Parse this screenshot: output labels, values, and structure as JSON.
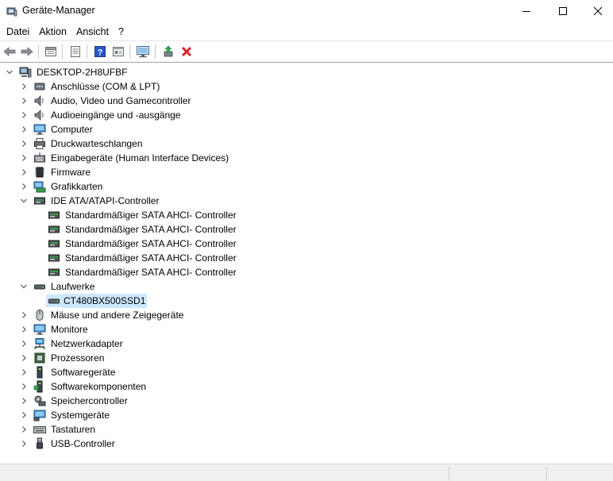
{
  "window": {
    "title": "Geräte-Manager"
  },
  "menu": {
    "items": [
      "Datei",
      "Aktion",
      "Ansicht",
      "?"
    ]
  },
  "toolbar": {
    "buttons": [
      "back-arrow-icon",
      "forward-arrow-icon",
      "properties-sheet-icon",
      "list-view-icon",
      "help-icon",
      "details-view-icon",
      "scan-hardware-icon",
      "update-driver-icon",
      "uninstall-x-icon"
    ]
  },
  "tree": {
    "root": {
      "label": "DESKTOP-2H8UFBF"
    },
    "items": [
      {
        "label": "Anschlüsse (COM & LPT)",
        "icon": "port-icon"
      },
      {
        "label": "Audio, Video und Gamecontroller",
        "icon": "speaker-icon"
      },
      {
        "label": "Audioeingänge und -ausgänge",
        "icon": "speaker-icon"
      },
      {
        "label": "Computer",
        "icon": "monitor-icon"
      },
      {
        "label": "Druckwarteschlangen",
        "icon": "printer-icon"
      },
      {
        "label": "Eingabegeräte (Human Interface Devices)",
        "icon": "hid-icon"
      },
      {
        "label": "Firmware",
        "icon": "chip-icon"
      },
      {
        "label": "Grafikkarten",
        "icon": "display-adapter-icon"
      },
      {
        "label": "IDE ATA/ATAPI-Controller",
        "icon": "controller-icon"
      },
      {
        "label": "Standardmäßiger SATA AHCI- Controller",
        "icon": "controller-icon"
      },
      {
        "label": "Standardmäßiger SATA AHCI- Controller",
        "icon": "controller-icon"
      },
      {
        "label": "Standardmäßiger SATA AHCI- Controller",
        "icon": "controller-icon"
      },
      {
        "label": "Standardmäßiger SATA AHCI- Controller",
        "icon": "controller-icon"
      },
      {
        "label": "Standardmäßiger SATA AHCI- Controller",
        "icon": "controller-icon"
      },
      {
        "label": "Laufwerke",
        "icon": "drive-icon"
      },
      {
        "label": "CT480BX500SSD1",
        "icon": "drive-icon"
      },
      {
        "label": "Mäuse und andere Zeigegeräte",
        "icon": "mouse-icon"
      },
      {
        "label": "Monitore",
        "icon": "monitor-icon"
      },
      {
        "label": "Netzwerkadapter",
        "icon": "network-icon"
      },
      {
        "label": "Prozessoren",
        "icon": "cpu-icon"
      },
      {
        "label": "Softwaregeräte",
        "icon": "software-device-icon"
      },
      {
        "label": "Softwarekomponenten",
        "icon": "software-component-icon"
      },
      {
        "label": "Speichercontroller",
        "icon": "storage-controller-icon"
      },
      {
        "label": "Systemgeräte",
        "icon": "system-icon"
      },
      {
        "label": "Tastaturen",
        "icon": "keyboard-icon"
      },
      {
        "label": "USB-Controller",
        "icon": "usb-icon"
      }
    ]
  },
  "colors": {
    "selection": "#cce8ff",
    "uninstall": "#d9242b",
    "help": "#2a56c6"
  }
}
